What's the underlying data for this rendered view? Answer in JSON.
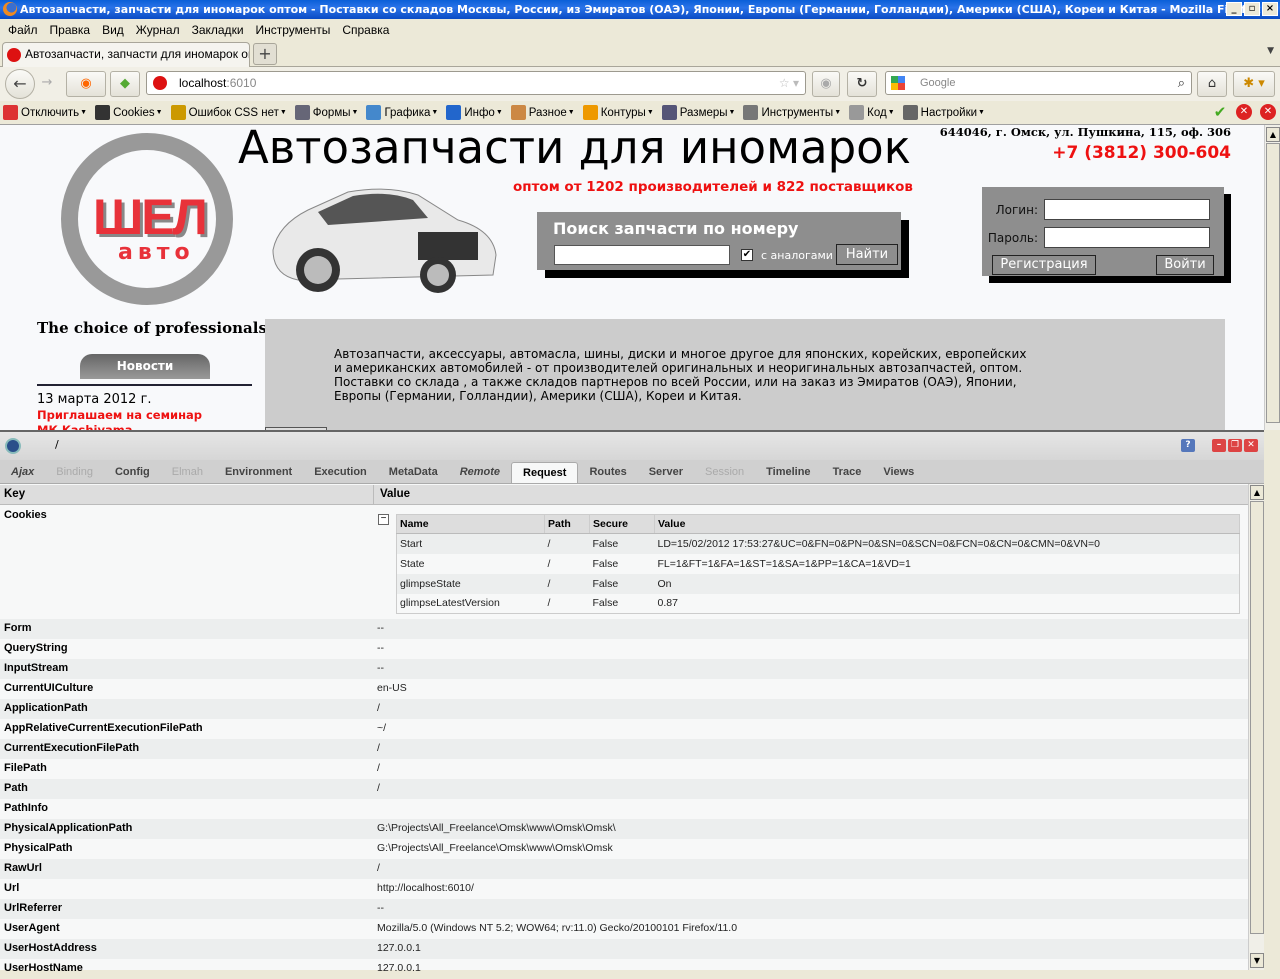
{
  "window": {
    "title": "Автозапчасти, запчасти для иномарок оптом - Поставки со складов Москвы, России, из Эмиратов (ОАЭ), Японии, Европы (Германии, Голландии), Америки (США), Кореи и Китая - Mozilla Firefox",
    "controls": [
      "_",
      "▫",
      "×"
    ]
  },
  "menu": [
    "Файл",
    "Правка",
    "Вид",
    "Журнал",
    "Закладки",
    "Инструменты",
    "Справка"
  ],
  "tab": {
    "title": "Автозапчасти, запчасти для иномарок оп...",
    "new": "+"
  },
  "nav": {
    "url_host": "localhost",
    "url_port": ":6010",
    "search_placeholder": "Google"
  },
  "devtoolbar": [
    {
      "label": "Отключить",
      "icon": "disable-icon",
      "color": "#d33"
    },
    {
      "label": "Cookies",
      "icon": "cookies-icon",
      "color": "#333"
    },
    {
      "label": "Ошибок CSS нет",
      "icon": "css-wand-icon",
      "color": "#c90"
    },
    {
      "label": "Формы",
      "icon": "forms-icon",
      "color": "#667"
    },
    {
      "label": "Графика",
      "icon": "images-icon",
      "color": "#48c"
    },
    {
      "label": "Инфо",
      "icon": "info-icon",
      "color": "#26c"
    },
    {
      "label": "Разное",
      "icon": "misc-icon",
      "color": "#c84"
    },
    {
      "label": "Контуры",
      "icon": "outline-pencil-icon",
      "color": "#e90"
    },
    {
      "label": "Размеры",
      "icon": "resize-icon",
      "color": "#557"
    },
    {
      "label": "Инструменты",
      "icon": "tools-icon",
      "color": "#777"
    },
    {
      "label": "Код",
      "icon": "source-icon",
      "color": "#999"
    },
    {
      "label": "Настройки",
      "icon": "options-icon",
      "color": "#666"
    }
  ],
  "site": {
    "logo_main": "ШЕЛ",
    "logo_sub": "авто",
    "headline": "Автозапчасти для иномарок",
    "subheadline": "оптом от 1202 производителей и 822 поставщиков",
    "address": "644046, г. Омск, ул. Пушкина, 115, оф. 306",
    "phone": "+7 (3812) 300-604",
    "search": {
      "title": "Поиск запчасти по номеру",
      "analogs_label": "с аналогами",
      "analogs_checked": true,
      "button": "Найти"
    },
    "login": {
      "login_label": "Логин:",
      "password_label": "Пароль:",
      "register": "Регистрация",
      "submit": "Войти"
    },
    "slogan": "The choice of professionals",
    "news": {
      "tab": "Новости",
      "date": "13 марта 2012 г.",
      "link": "Приглашаем на семинар МК Kashiyama"
    },
    "intro": "Автозапчасти, аксессуары, автомасла, шины, диски и многое другое для японских, корейских, европейских и американских автомобилей - от производителей оригинальных и неоригинальных автозапчастей, оптом. Поставки со склада , а также складов партнеров по всей России, или на заказ из Эмиратов (ОАЭ), Японии, Европы (Германии, Голландии), Америки (США), Кореи и Китая."
  },
  "glimpse": {
    "path": "/",
    "tabs": [
      {
        "label": "Ajax",
        "state": "italic"
      },
      {
        "label": "Binding",
        "state": "disabled"
      },
      {
        "label": "Config",
        "state": "normal"
      },
      {
        "label": "Elmah",
        "state": "disabled"
      },
      {
        "label": "Environment",
        "state": "normal"
      },
      {
        "label": "Execution",
        "state": "normal"
      },
      {
        "label": "MetaData",
        "state": "normal"
      },
      {
        "label": "Remote",
        "state": "italic"
      },
      {
        "label": "Request",
        "state": "active"
      },
      {
        "label": "Routes",
        "state": "normal"
      },
      {
        "label": "Server",
        "state": "normal"
      },
      {
        "label": "Session",
        "state": "disabled"
      },
      {
        "label": "Timeline",
        "state": "normal"
      },
      {
        "label": "Trace",
        "state": "normal"
      },
      {
        "label": "Views",
        "state": "normal"
      }
    ],
    "key_header": "Key",
    "value_header": "Value",
    "cookies": {
      "key": "Cookies",
      "columns": [
        "Name",
        "Path",
        "Secure",
        "Value"
      ],
      "rows": [
        [
          "Start",
          "/",
          "False",
          "LD=15/02/2012 17:53:27&UC=0&FN=0&PN=0&SN=0&SCN=0&FCN=0&CN=0&CMN=0&VN=0"
        ],
        [
          "State",
          "/",
          "False",
          "FL=1&FT=1&FA=1&ST=1&SA=1&PP=1&CA=1&VD=1"
        ],
        [
          "glimpseState",
          "/",
          "False",
          "On"
        ],
        [
          "glimpseLatestVersion",
          "/",
          "False",
          "0.87"
        ]
      ]
    },
    "rows": [
      {
        "key": "Form",
        "value": "--"
      },
      {
        "key": "QueryString",
        "value": "--"
      },
      {
        "key": "InputStream",
        "value": "--"
      },
      {
        "key": "CurrentUICulture",
        "value": "en-US"
      },
      {
        "key": "ApplicationPath",
        "value": "/"
      },
      {
        "key": "AppRelativeCurrentExecutionFilePath",
        "value": "~/"
      },
      {
        "key": "CurrentExecutionFilePath",
        "value": "/"
      },
      {
        "key": "FilePath",
        "value": "/"
      },
      {
        "key": "Path",
        "value": "/"
      },
      {
        "key": "PathInfo",
        "value": ""
      },
      {
        "key": "PhysicalApplicationPath",
        "value": "G:\\Projects\\All_Freelance\\Omsk\\www\\Omsk\\Omsk\\"
      },
      {
        "key": "PhysicalPath",
        "value": "G:\\Projects\\All_Freelance\\Omsk\\www\\Omsk\\Omsk"
      },
      {
        "key": "RawUrl",
        "value": "/"
      },
      {
        "key": "Url",
        "value": "http://localhost:6010/"
      },
      {
        "key": "UrlReferrer",
        "value": "--"
      },
      {
        "key": "UserAgent",
        "value": "Mozilla/5.0 (Windows NT 5.2; WOW64; rv:11.0) Gecko/20100101 Firefox/11.0"
      },
      {
        "key": "UserHostAddress",
        "value": "127.0.0.1"
      },
      {
        "key": "UserHostName",
        "value": "127.0.0.1"
      }
    ]
  }
}
